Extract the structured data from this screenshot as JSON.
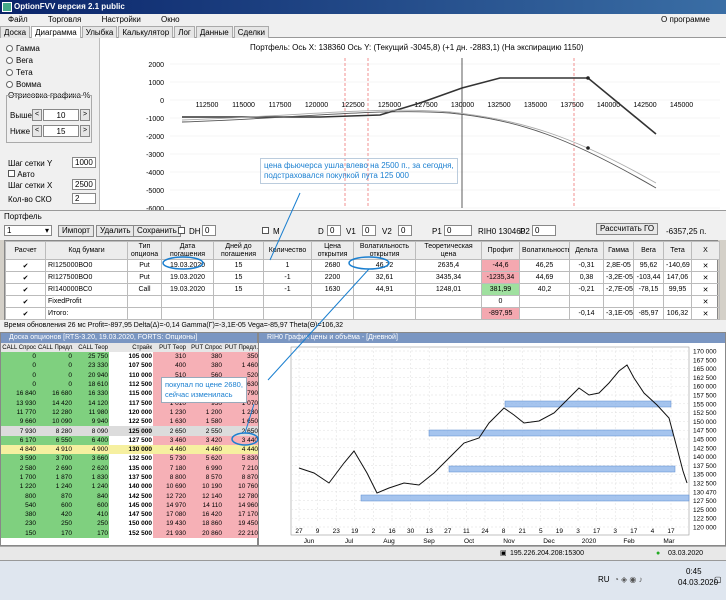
{
  "window": {
    "title": "OptionFVV версия 2.1 public"
  },
  "menu": {
    "items": [
      "Файл",
      "Торговля",
      "Настройки",
      "Окно"
    ],
    "about": "О программе"
  },
  "tabs": [
    "Доска",
    "Диаграмма",
    "Улыбка",
    "Калькулятор",
    "Лог",
    "Данные",
    "Сделки"
  ],
  "left_panel": {
    "radios": [
      "Гамма",
      "Вега",
      "Тета",
      "Вомма"
    ],
    "group_title": "Отрисовка графика %",
    "above_label": "Выше",
    "above_value": "10",
    "below_label": "Ниже",
    "below_value": "15",
    "grid_y_label": "Шаг сетки Y",
    "grid_y_value": "1000",
    "auto_label": "Авто",
    "grid_x_label": "Шаг сетки X",
    "grid_x_value": "2500",
    "sko_label": "Кол-во СКО",
    "sko_value": "2"
  },
  "payoff_chart": {
    "header": "Портфель:  Ось X:  138360  Ось Y:   (Текущий  -3045,8)  (+1 дн.  -2883,1)  (На экспирацию 1150)",
    "annotation_line1": "цена фьючерса ушла влево на 2500 п., за сегодня,",
    "annotation_line2": "подстраховался покупкой пута 125 000",
    "x_ticks": [
      "112500",
      "115000",
      "117500",
      "120000",
      "122500",
      "125000",
      "127500",
      "130000",
      "132500",
      "135000",
      "137500",
      "140000",
      "142500",
      "145000"
    ],
    "y_ticks": [
      "2000",
      "1000",
      "0",
      "-1000",
      "-2000",
      "-3000",
      "-4000",
      "-5000",
      "-6000"
    ]
  },
  "toolbar": {
    "portfolio_label": "Портфель",
    "portfolio_value": "1",
    "import": "Импорт",
    "delete": "Удалить",
    "save": "Сохранить",
    "dh_label": "DH",
    "dh_value": "0",
    "m_label": "M",
    "d_label": "D",
    "d_value": "0",
    "v1_label": "V1",
    "v1_value": "0",
    "v2_label": "V2",
    "v2_value": "0",
    "p1_label": "P1",
    "p1_value": "0",
    "ri_label": "RIH0 130460",
    "p2_label": "P2",
    "p2_value": "0",
    "calc": "Рассчитать ГО",
    "go_value": "-6357,25 п."
  },
  "positions": {
    "headers": [
      "Расчет",
      "Код бумаги",
      "Тип опциона",
      "Дата погашения",
      "Дней до погашения",
      "Количество",
      "Цена открытия",
      "Волатильность открытия",
      "Теоретическая цена",
      "Профит",
      "Волатильность",
      "Дельта",
      "Гамма",
      "Вега",
      "Тета",
      "X"
    ],
    "rows": [
      [
        "✔",
        "RI125000BO0",
        "Put",
        "19.03.2020",
        "15",
        "1",
        "2680",
        "46,72",
        "2635,4",
        "-44,6",
        "46,25",
        "-0,31",
        "2,8E-05",
        "95,62",
        "-140,69",
        "✕"
      ],
      [
        "✔",
        "RI127500BO0",
        "Put",
        "19.03.2020",
        "15",
        "-1",
        "2200",
        "32,61",
        "3435,34",
        "-1235,34",
        "44,69",
        "0,38",
        "-3,2E-05",
        "-103,44",
        "147,06",
        "✕"
      ],
      [
        "✔",
        "RI140000BC0",
        "Call",
        "19.03.2020",
        "15",
        "-1",
        "1630",
        "44,91",
        "1248,01",
        "381,99",
        "40,2",
        "-0,21",
        "-2,7E-05",
        "-78,15",
        "99,95",
        "✕"
      ],
      [
        "✔",
        "FixedProfit",
        "",
        "",
        "",
        "",
        "",
        "",
        "",
        "0",
        "",
        "",
        "",
        "",
        "",
        "✕"
      ],
      [
        "✔",
        "Итого:",
        "",
        "",
        "",
        "",
        "",
        "",
        "",
        "-897,95",
        "",
        "-0,14",
        "-3,1E-05",
        "-85,97",
        "106,32",
        "✕"
      ]
    ]
  },
  "status_line": "Время обновления 26 мс  Profit=-897,95 Delta(Δ)=-0,14 Gamma(Γ)=-3,1E-05 Vega=-85,97 Theta(Θ)=106,32",
  "board": {
    "title": "Доска опционов [RTS-3.20, 19.03.2020, FORTS: Опционы]",
    "headers": [
      "CALL Спрос",
      "CALL Предл.",
      "CALL Теор",
      "Страйк",
      "PUT Теор",
      "PUT Спрос",
      "PUT Предл."
    ],
    "rows": [
      [
        "0",
        "0",
        "25 750",
        "105 000",
        "310",
        "380",
        "350"
      ],
      [
        "0",
        "0",
        "23 330",
        "107 500",
        "400",
        "380",
        "1 460"
      ],
      [
        "0",
        "0",
        "20 940",
        "110 000",
        "510",
        "560",
        "520"
      ],
      [
        "0",
        "0",
        "18 610",
        "112 500",
        "640",
        "620",
        "630"
      ],
      [
        "16 840",
        "16 680",
        "16 330",
        "115 000",
        "810",
        "770",
        "790"
      ],
      [
        "13 930",
        "14 420",
        "14 120",
        "117 500",
        "1 010",
        "950",
        "1 070"
      ],
      [
        "11 770",
        "12 280",
        "11 980",
        "120 000",
        "1 230",
        "1 200",
        "1 230"
      ],
      [
        "9 660",
        "10 090",
        "9 940",
        "122 500",
        "1 630",
        "1 580",
        "1 650"
      ],
      [
        "7 930",
        "8 280",
        "8 090",
        "125 000",
        "2 650",
        "2 550",
        "2 650"
      ],
      [
        "6 170",
        "6 550",
        "6 400",
        "127 500",
        "3 460",
        "3 420",
        "3 440"
      ],
      [
        "4 840",
        "4 910",
        "4 900",
        "130 000",
        "4 460",
        "4 460",
        "4 440"
      ],
      [
        "3 590",
        "3 700",
        "3 660",
        "132 500",
        "5 730",
        "5 620",
        "5 830"
      ],
      [
        "2 580",
        "2 690",
        "2 620",
        "135 000",
        "7 180",
        "6 990",
        "7 210"
      ],
      [
        "1 700",
        "1 870",
        "1 830",
        "137 500",
        "8 800",
        "8 570",
        "8 870"
      ],
      [
        "1 220",
        "1 240",
        "1 240",
        "140 000",
        "10 690",
        "10 190",
        "10 760"
      ],
      [
        "800",
        "870",
        "840",
        "142 500",
        "12 720",
        "12 140",
        "12 780"
      ],
      [
        "540",
        "600",
        "600",
        "145 000",
        "14 970",
        "14 110",
        "14 960"
      ],
      [
        "380",
        "420",
        "410",
        "147 500",
        "17 080",
        "16 420",
        "17 170"
      ],
      [
        "230",
        "250",
        "250",
        "150 000",
        "19 430",
        "18 860",
        "19 450"
      ],
      [
        "150",
        "170",
        "170",
        "152 500",
        "21 930",
        "20 860",
        "22 210"
      ]
    ],
    "annotation_line1": "покупал по цене 2680,",
    "annotation_line2": "сейчас изменилась"
  },
  "price_chart": {
    "title": "RIH0 График цены и объёма - [Дневной]",
    "y_ticks": [
      "170 000",
      "167 500",
      "165 000",
      "162 500",
      "160 000",
      "157 500",
      "155 000",
      "152 500",
      "150 000",
      "147 500",
      "145 000",
      "142 500",
      "140 000",
      "137 500",
      "135 000",
      "132 500",
      "130 470",
      "127 500",
      "125 000",
      "122 500",
      "120 000"
    ],
    "x_ticks_top": [
      "27",
      "9",
      "23",
      "19",
      "2",
      "16",
      "30",
      "13",
      "27",
      "11",
      "24",
      "8",
      "21",
      "5",
      "19",
      "3",
      "17",
      "3",
      "17",
      "4",
      "17"
    ],
    "x_ticks_bottom": [
      "Jun",
      "Jul",
      "Aug",
      "Sep",
      "Oct",
      "Nov",
      "Dec",
      "2020",
      "Feb",
      "Mar"
    ]
  },
  "bottom_status": {
    "ip": "195.226.204.208:15300",
    "date": "03.03.2020"
  },
  "taskbar": {
    "lang": "RU",
    "time": "0:45",
    "date": "04.03.2020"
  }
}
